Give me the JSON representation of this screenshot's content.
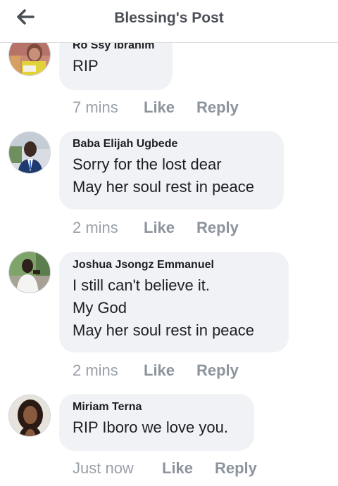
{
  "header": {
    "back_icon": "arrow-left-icon",
    "title": "Blessing's Post"
  },
  "comments": [
    {
      "author": "Ro Ssy Ibrahim",
      "lines": [
        "RIP"
      ],
      "time": "7 mins",
      "like_label": "Like",
      "reply_label": "Reply"
    },
    {
      "author": "Baba Elijah Ugbede",
      "lines": [
        "Sorry for the lost dear",
        "May her soul rest in peace"
      ],
      "time": "2 mins",
      "like_label": "Like",
      "reply_label": "Reply"
    },
    {
      "author": "Joshua Jsongz Emmanuel",
      "lines": [
        "I still can't believe it.",
        "My God",
        "May her soul rest in peace"
      ],
      "time": "2 mins",
      "like_label": "Like",
      "reply_label": "Reply"
    },
    {
      "author": "Miriam Terna",
      "lines": [
        "RIP Iboro we love you."
      ],
      "time": "Just now",
      "like_label": "Like",
      "reply_label": "Reply"
    }
  ],
  "colors": {
    "bubble": "#f0f2f5",
    "text": "#1c1e21",
    "meta": "#8d949e",
    "header_title": "#4b4f56"
  }
}
